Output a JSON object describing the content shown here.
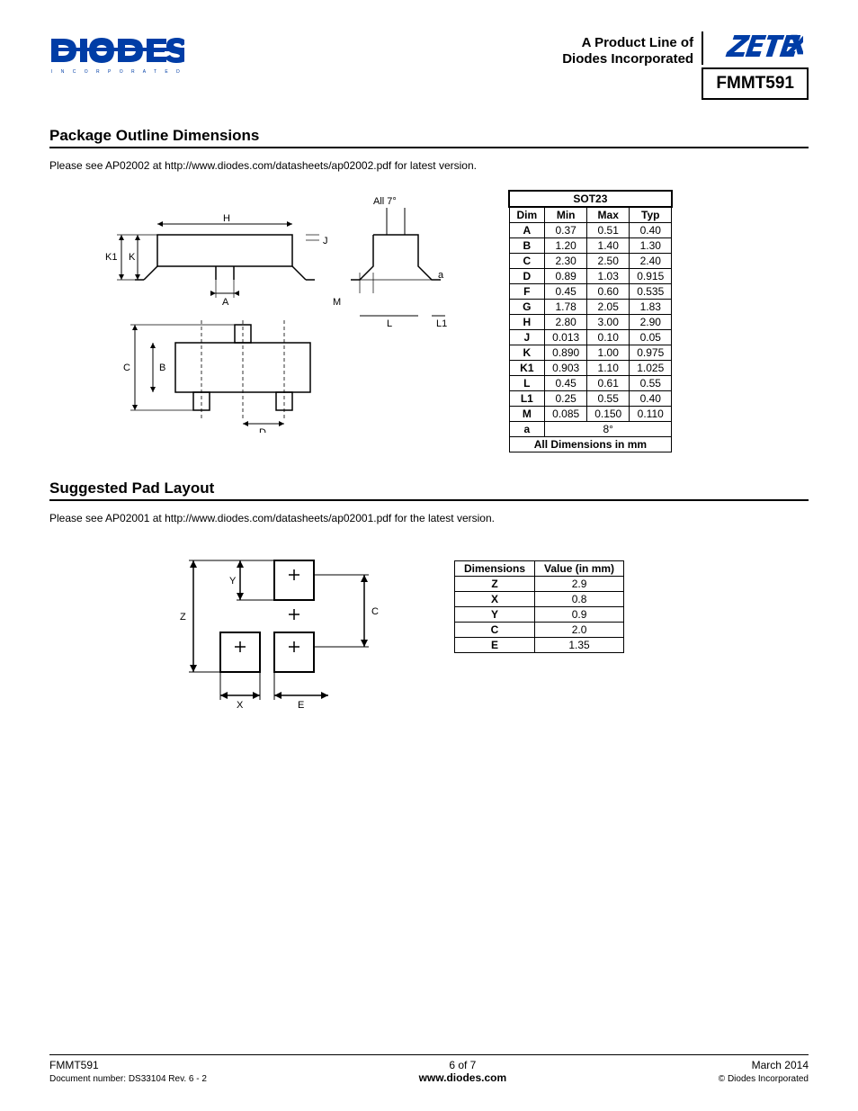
{
  "header": {
    "tagline_l1": "A Product Line of",
    "tagline_l2": "Diodes Incorporated",
    "part": "FMMT591"
  },
  "sections": {
    "pkg_title": "Package Outline Dimensions",
    "pkg_note": "Please see AP02002 at http://www.diodes.com/datasheets/ap02002.pdf for latest version.",
    "pad_title": "Suggested Pad Layout",
    "pad_note": "Please see AP02001 at http://www.diodes.com/datasheets/ap02001.pdf for the latest version."
  },
  "diagram_pkg": {
    "top_note": "All 7°",
    "labels": {
      "H": "H",
      "J": "J",
      "K1": "K1",
      "K": "K",
      "A": "A",
      "M": "M",
      "a": "a",
      "L": "L",
      "L1": "L1",
      "C": "C",
      "B": "B",
      "D": "D"
    }
  },
  "diagram_pad": {
    "labels": {
      "Z": "Z",
      "Y": "Y",
      "C": "C",
      "X": "X",
      "E": "E"
    }
  },
  "pkg_table": {
    "title": "SOT23",
    "headers": {
      "dim": "Dim",
      "min": "Min",
      "max": "Max",
      "typ": "Typ"
    },
    "rows": [
      {
        "dim": "A",
        "min": "0.37",
        "max": "0.51",
        "typ": "0.40"
      },
      {
        "dim": "B",
        "min": "1.20",
        "max": "1.40",
        "typ": "1.30"
      },
      {
        "dim": "C",
        "min": "2.30",
        "max": "2.50",
        "typ": "2.40"
      },
      {
        "dim": "D",
        "min": "0.89",
        "max": "1.03",
        "typ": "0.915"
      },
      {
        "dim": "F",
        "min": "0.45",
        "max": "0.60",
        "typ": "0.535"
      },
      {
        "dim": "G",
        "min": "1.78",
        "max": "2.05",
        "typ": "1.83"
      },
      {
        "dim": "H",
        "min": "2.80",
        "max": "3.00",
        "typ": "2.90"
      },
      {
        "dim": "J",
        "min": "0.013",
        "max": "0.10",
        "typ": "0.05"
      },
      {
        "dim": "K",
        "min": "0.890",
        "max": "1.00",
        "typ": "0.975"
      },
      {
        "dim": "K1",
        "min": "0.903",
        "max": "1.10",
        "typ": "1.025"
      },
      {
        "dim": "L",
        "min": "0.45",
        "max": "0.61",
        "typ": "0.55"
      },
      {
        "dim": "L1",
        "min": "0.25",
        "max": "0.55",
        "typ": "0.40"
      },
      {
        "dim": "M",
        "min": "0.085",
        "max": "0.150",
        "typ": "0.110"
      }
    ],
    "angle_row": {
      "dim": "a",
      "val": "8°"
    },
    "footer": "All Dimensions in mm"
  },
  "pad_table": {
    "headers": {
      "dim": "Dimensions",
      "val": "Value (in mm)"
    },
    "rows": [
      {
        "dim": "Z",
        "val": "2.9"
      },
      {
        "dim": "X",
        "val": "0.8"
      },
      {
        "dim": "Y",
        "val": "0.9"
      },
      {
        "dim": "C",
        "val": "2.0"
      },
      {
        "dim": "E",
        "val": "1.35"
      }
    ]
  },
  "footer": {
    "part": "FMMT591",
    "docnum": "Document number: DS33104 Rev. 6 - 2",
    "page": "6 of 7",
    "url": "www.diodes.com",
    "date": "March 2014",
    "copyright": "© Diodes Incorporated"
  }
}
